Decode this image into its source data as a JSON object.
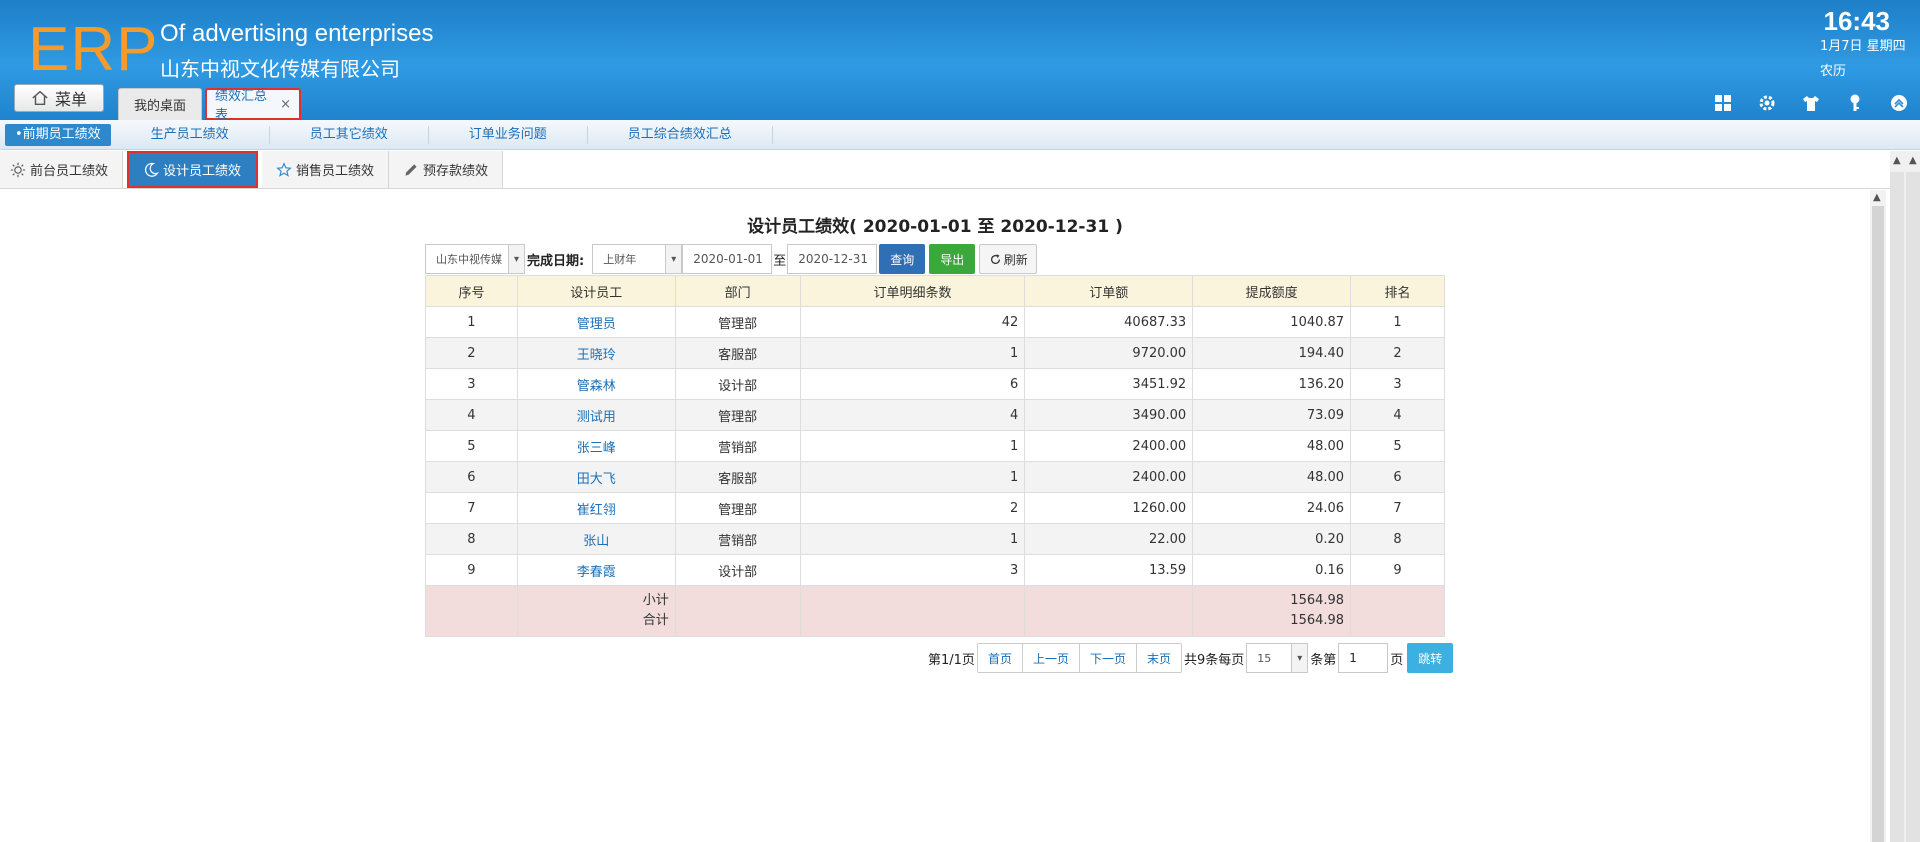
{
  "header": {
    "logo": "ERP",
    "company_en": "Of advertising enterprises",
    "company_cn": "山东中视文化传媒有限公司",
    "time": "16:43",
    "date": "1月7日 星期四",
    "lunar": "农历",
    "menu_label": "菜单",
    "tabs": [
      {
        "label": "我的桌面"
      },
      {
        "label": "绩效汇总表",
        "close": "×"
      }
    ],
    "icons": [
      "dashboard-icon",
      "gear-icon",
      "shirt-icon",
      "key-icon",
      "collapse-up-icon"
    ]
  },
  "subnav": {
    "items": [
      {
        "label": "•前期员工绩效"
      },
      {
        "label": "生产员工绩效"
      },
      {
        "label": "员工其它绩效"
      },
      {
        "label": "订单业务问题"
      },
      {
        "label": "员工综合绩效汇总"
      }
    ]
  },
  "subtabs": {
    "items": [
      {
        "label": "前台员工绩效"
      },
      {
        "label": "设计员工绩效"
      },
      {
        "label": "销售员工绩效"
      },
      {
        "label": "预存款绩效"
      }
    ]
  },
  "report": {
    "title": "设计员工绩效( 2020-01-01 至 2020-12-31 )"
  },
  "filter": {
    "company": "山东中视传媒",
    "date_label": "完成日期:",
    "period": "上财年",
    "start_date": "2020-01-01",
    "to_label": "至",
    "end_date": "2020-12-31",
    "query_label": "查询",
    "export_label": "导出",
    "refresh_label": "刷新"
  },
  "table": {
    "columns": [
      "序号",
      "设计员工",
      "部门",
      "订单明细条数",
      "订单额",
      "提成额度",
      "排名"
    ],
    "rows": [
      {
        "no": "1",
        "name": "管理员",
        "dept": "管理部",
        "count": "42",
        "amount": "40687.33",
        "commission": "1040.87",
        "rank": "1"
      },
      {
        "no": "2",
        "name": "王晓玲",
        "dept": "客服部",
        "count": "1",
        "amount": "9720.00",
        "commission": "194.40",
        "rank": "2"
      },
      {
        "no": "3",
        "name": "管森林",
        "dept": "设计部",
        "count": "6",
        "amount": "3451.92",
        "commission": "136.20",
        "rank": "3"
      },
      {
        "no": "4",
        "name": "测试用",
        "dept": "管理部",
        "count": "4",
        "amount": "3490.00",
        "commission": "73.09",
        "rank": "4"
      },
      {
        "no": "5",
        "name": "张三峰",
        "dept": "营销部",
        "count": "1",
        "amount": "2400.00",
        "commission": "48.00",
        "rank": "5"
      },
      {
        "no": "6",
        "name": "田大飞",
        "dept": "客服部",
        "count": "1",
        "amount": "2400.00",
        "commission": "48.00",
        "rank": "6"
      },
      {
        "no": "7",
        "name": "崔红翎",
        "dept": "管理部",
        "count": "2",
        "amount": "1260.00",
        "commission": "24.06",
        "rank": "7"
      },
      {
        "no": "8",
        "name": "张山",
        "dept": "营销部",
        "count": "1",
        "amount": "22.00",
        "commission": "0.20",
        "rank": "8"
      },
      {
        "no": "9",
        "name": "李春霞",
        "dept": "设计部",
        "count": "3",
        "amount": "13.59",
        "commission": "0.16",
        "rank": "9"
      }
    ],
    "subtotal_label": "小计",
    "total_label": "合计",
    "subtotal_value": "1564.98",
    "total_value": "1564.98"
  },
  "pager": {
    "page_info": "第1/1页",
    "first": "首页",
    "prev": "上一页",
    "next": "下一页",
    "last": "末页",
    "total_info": "共9条每页",
    "page_size": "15",
    "unit_label": "条第",
    "page_input": "1",
    "page_suffix": "页",
    "jump_label": "跳转"
  }
}
